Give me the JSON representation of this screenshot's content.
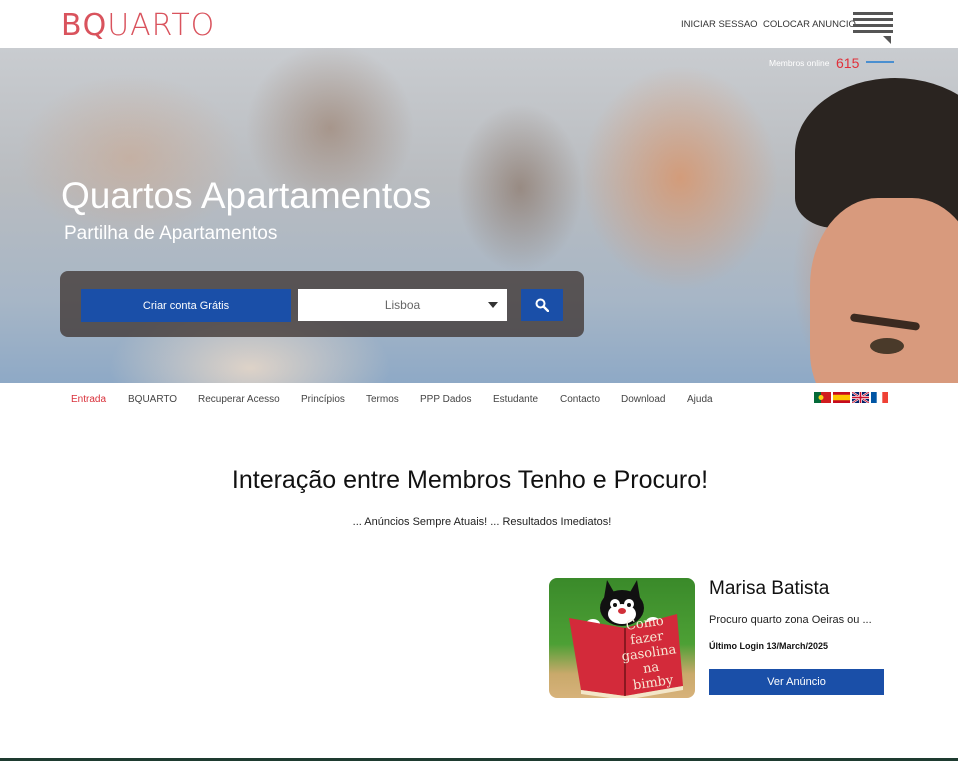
{
  "header": {
    "logo_bold": "BQ",
    "logo_rest": "UARTO",
    "login_label": "INICIAR SESSAO",
    "post_label": "COLOCAR ANUNCIO",
    "menu_icon": "hamburger-menu-icon"
  },
  "hero": {
    "members_label": "Membros online",
    "members_count": "615",
    "title": "Quartos Apartamentos",
    "subtitle": "Partilha de Apartamentos",
    "create_button": "Criar conta Grátis",
    "city_select": "Lisboa",
    "search_icon": "search-icon"
  },
  "nav": {
    "items": [
      "Entrada",
      "BQUARTO",
      "Recuperar Acesso",
      "Princípios",
      "Termos",
      "PPP Dados",
      "Estudante",
      "Contacto",
      "Download",
      "Ajuda"
    ],
    "active_index": 0,
    "flags": [
      "portugal-flag-icon",
      "spain-flag-icon",
      "uk-flag-icon",
      "france-flag-icon"
    ]
  },
  "main": {
    "headline": "Interação entre Membros Tenho e Procuro!",
    "tagline": "... Anúncios Sempre Atuais! ... Resultados Imediatos!"
  },
  "card": {
    "name": "Marisa Batista",
    "description": "Procuro quarto zona Oeiras ou ...",
    "last_login": "Último Login 13/March/2025",
    "button": "Ver Anúncio",
    "image_book_text": [
      "Como",
      "fazer",
      "gasolina",
      "na bimby"
    ]
  },
  "colors": {
    "brand": "#d9535d",
    "primary_button": "#1a4fa8",
    "active_nav": "#d9303a",
    "members_count": "#e0303a"
  }
}
